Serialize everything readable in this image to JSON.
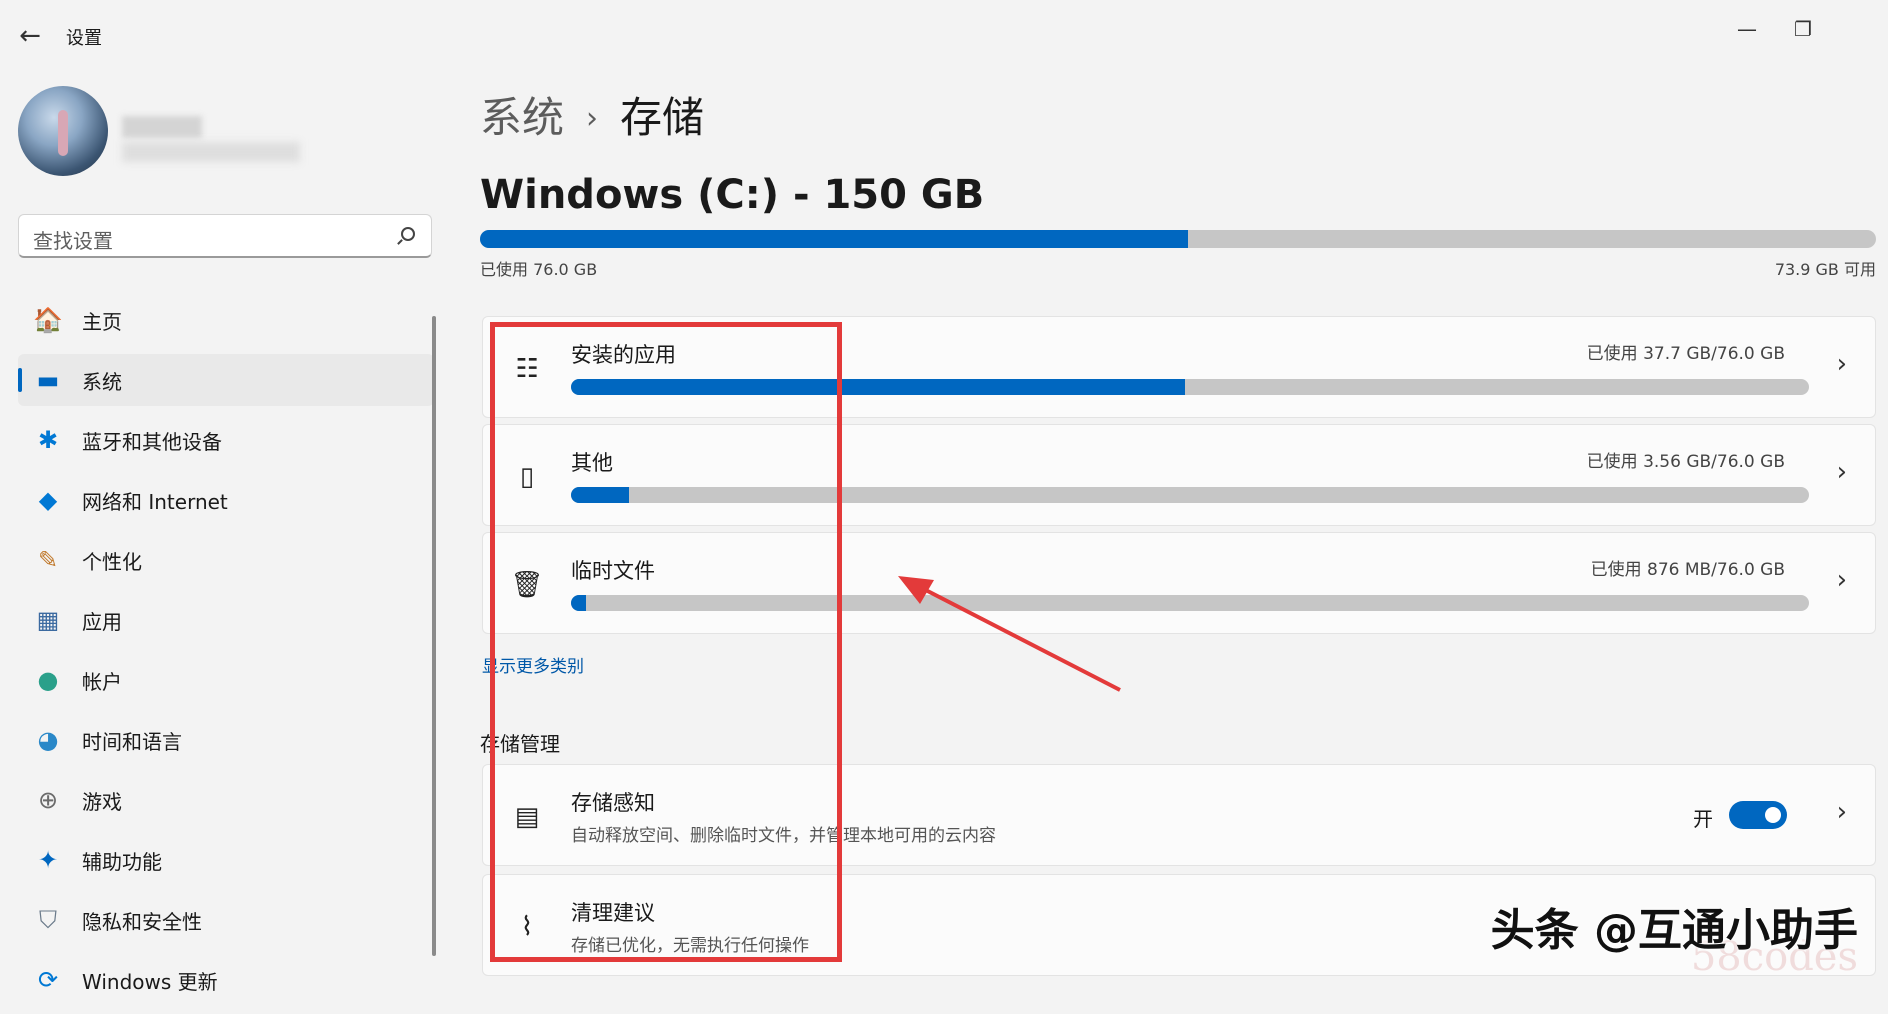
{
  "app": {
    "title": "设置",
    "back_glyph": "←",
    "minimize_glyph": "—",
    "restore_glyph": "❐"
  },
  "search": {
    "placeholder": "查找设置"
  },
  "nav": [
    {
      "label": "主页",
      "icon": "home-icon",
      "glyph": "🏠"
    },
    {
      "label": "系统",
      "icon": "system-icon",
      "glyph": "▬",
      "active": true
    },
    {
      "label": "蓝牙和其他设备",
      "icon": "bluetooth-icon",
      "glyph": "✱"
    },
    {
      "label": "网络和 Internet",
      "icon": "wifi-icon",
      "glyph": "◆"
    },
    {
      "label": "个性化",
      "icon": "brush-icon",
      "glyph": "✎"
    },
    {
      "label": "应用",
      "icon": "apps-icon",
      "glyph": "▦"
    },
    {
      "label": "帐户",
      "icon": "account-icon",
      "glyph": "●"
    },
    {
      "label": "时间和语言",
      "icon": "globe-clock-icon",
      "glyph": "◕"
    },
    {
      "label": "游戏",
      "icon": "gamepad-icon",
      "glyph": "⊕"
    },
    {
      "label": "辅助功能",
      "icon": "accessibility-icon",
      "glyph": "✦"
    },
    {
      "label": "隐私和安全性",
      "icon": "shield-icon",
      "glyph": "⛉"
    },
    {
      "label": "Windows 更新",
      "icon": "update-icon",
      "glyph": "⟳"
    }
  ],
  "breadcrumb": {
    "parent": "系统",
    "separator": "›",
    "current": "存储"
  },
  "drive": {
    "title": "Windows (C:) - 150 GB",
    "used_label": "已使用 76.0 GB",
    "free_label": "73.9 GB 可用",
    "used_fraction": 0.507
  },
  "categories": [
    {
      "title": "安装的应用",
      "value": "已使用 37.7 GB/76.0 GB",
      "fraction": 0.496,
      "icon": "list-icon",
      "glyph": "☷"
    },
    {
      "title": "其他",
      "value": "已使用 3.56 GB/76.0 GB",
      "fraction": 0.047,
      "icon": "document-icon",
      "glyph": "▯"
    },
    {
      "title": "临时文件",
      "value": "已使用 876 MB/76.0 GB",
      "fraction": 0.012,
      "icon": "trash-icon",
      "glyph": "🗑"
    }
  ],
  "show_more": "显示更多类别",
  "management": {
    "heading": "存储管理",
    "items": [
      {
        "title": "存储感知",
        "subtitle": "自动释放空间、删除临时文件，并管理本地可用的云内容",
        "toggle_label": "开",
        "icon": "storage-icon",
        "glyph": "▤"
      },
      {
        "title": "清理建议",
        "subtitle": "存储已优化，无需执行任何操作",
        "icon": "broom-icon",
        "glyph": "⌇"
      }
    ]
  },
  "chevron": "›",
  "watermark": "头条 @互通小助手",
  "watermark2": "58codes",
  "colors": {
    "accent": "#0067c0",
    "annotation": "#e33a3a"
  }
}
